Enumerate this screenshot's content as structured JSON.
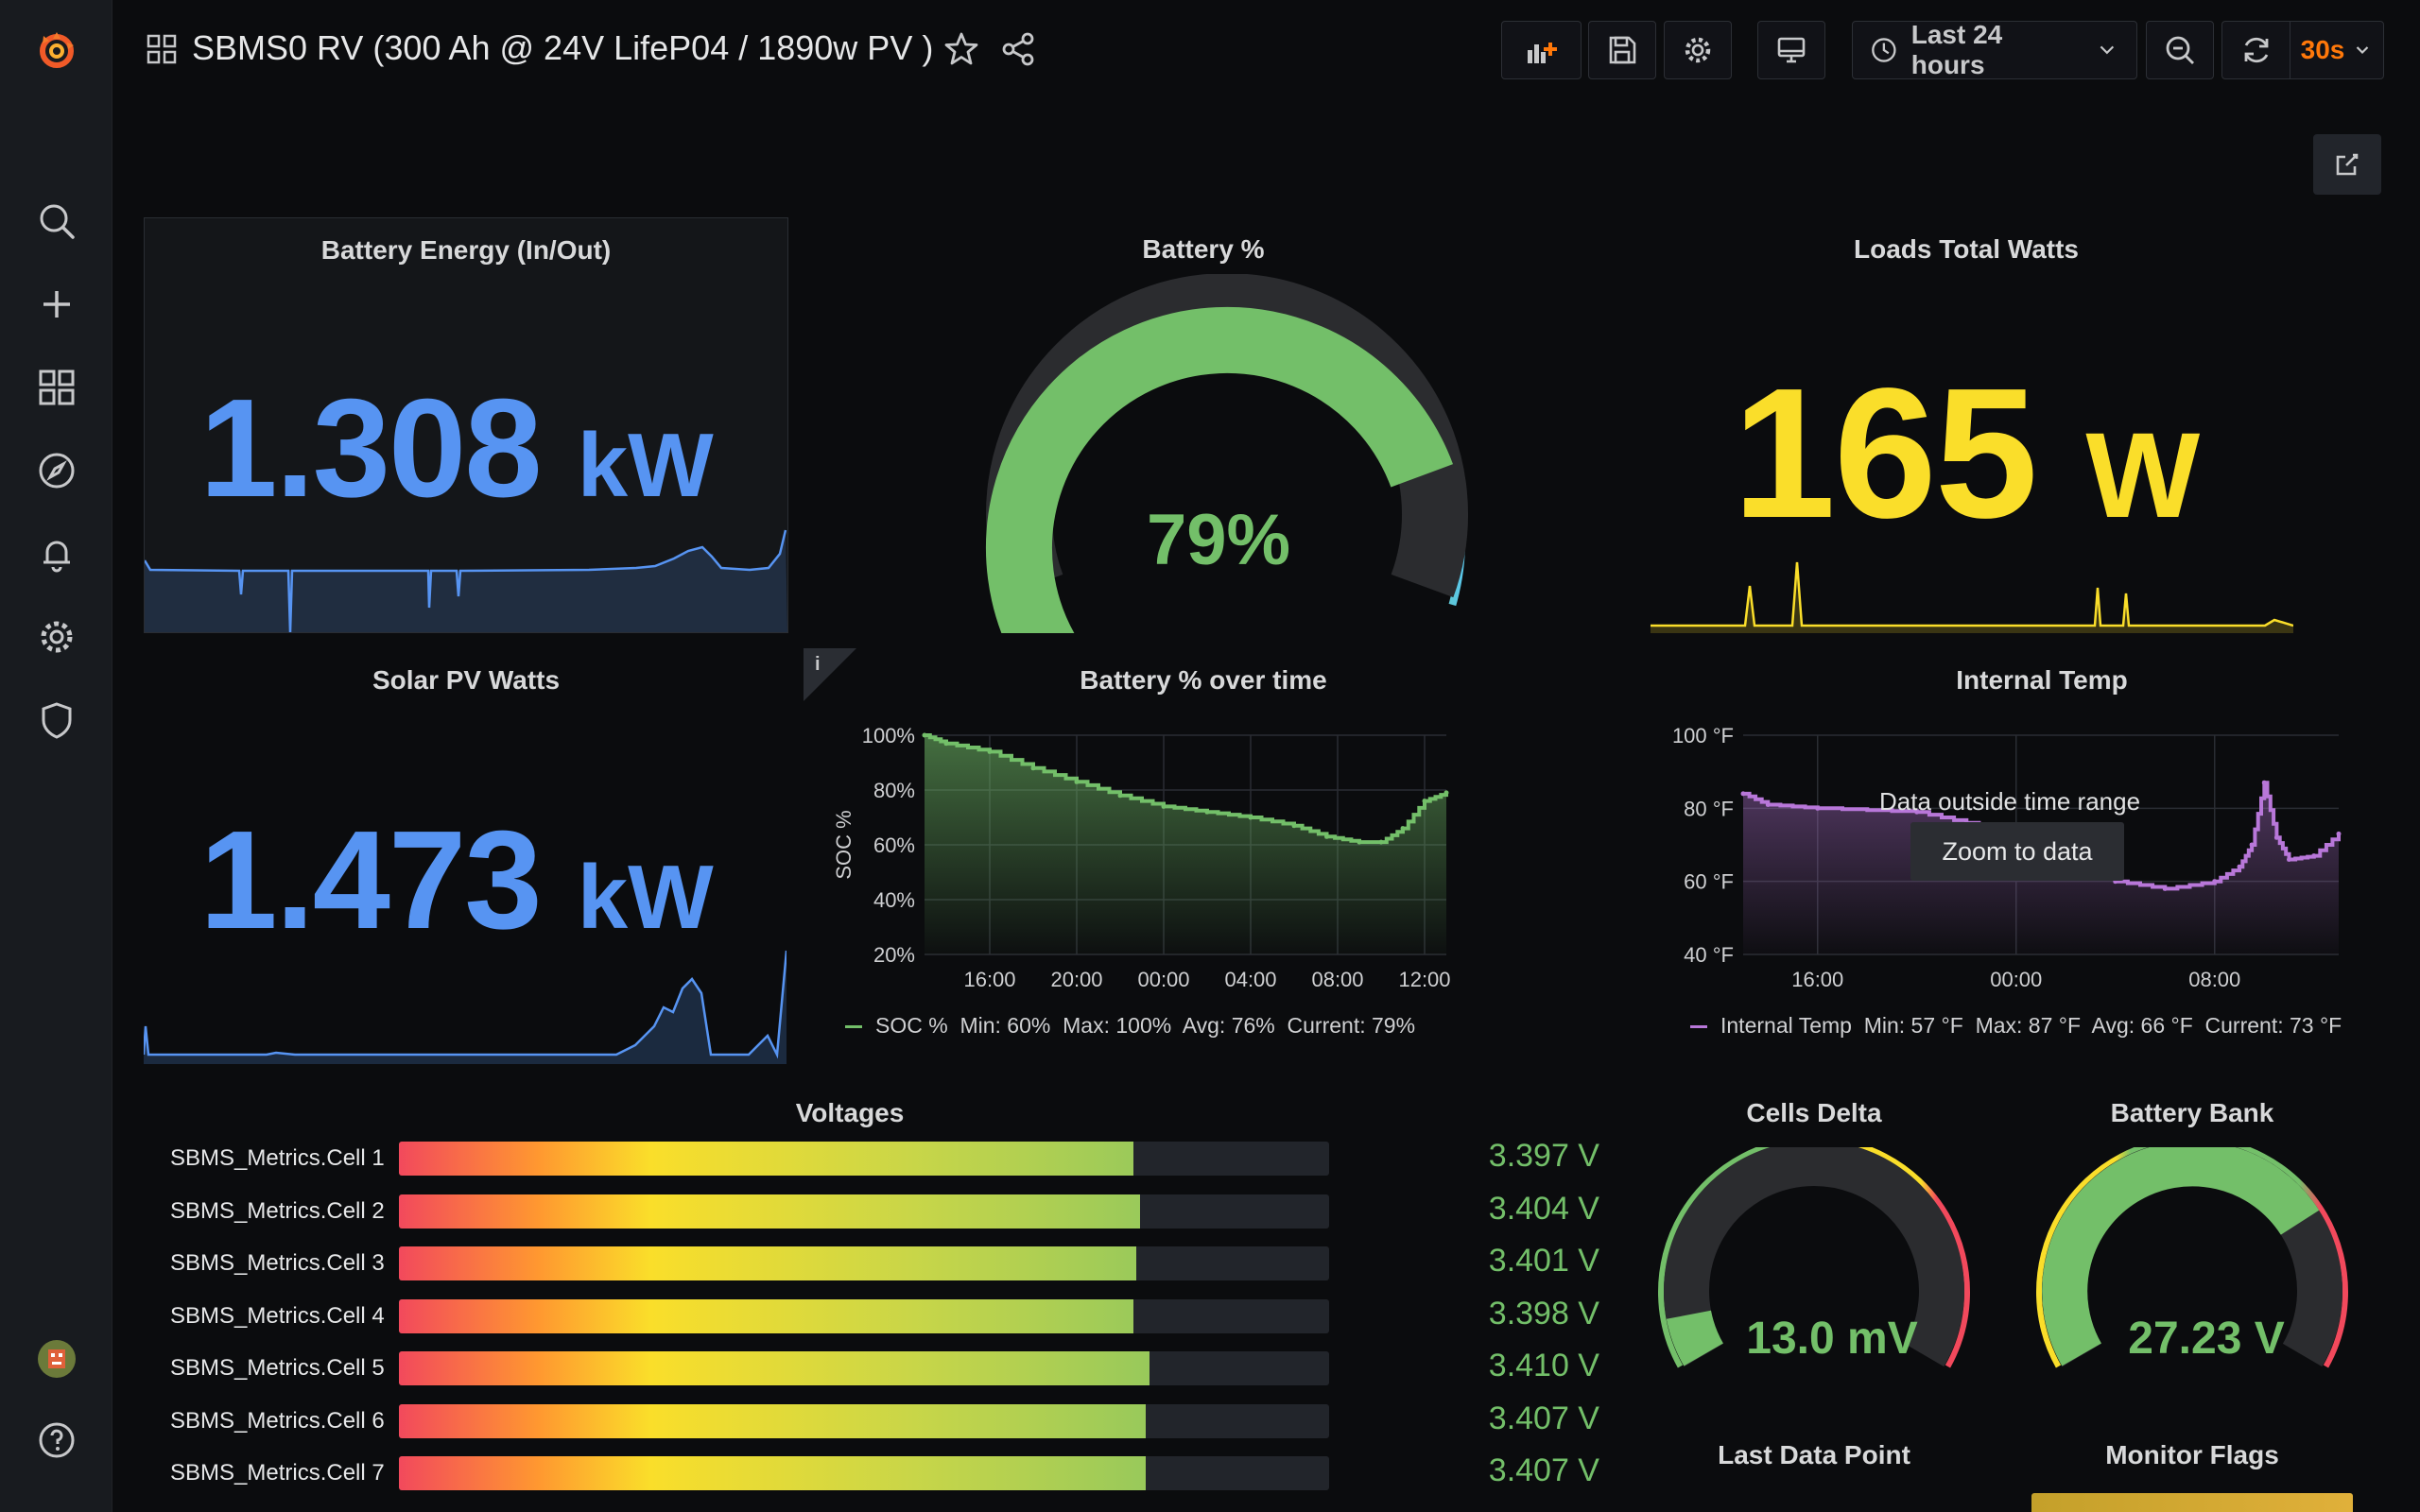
{
  "header": {
    "title": "SBMS0 RV (300 Ah @ 24V LifeP04 / 1890w PV )",
    "time_range": "Last 24 hours",
    "refresh_interval": "30s"
  },
  "sidebar": {
    "items": [
      "search-icon",
      "plus-icon",
      "dashboards-icon",
      "explore-icon",
      "alerting-icon",
      "settings-icon",
      "shield-icon"
    ]
  },
  "panels": {
    "battery_energy": {
      "title": "Battery Energy (In/Out)",
      "value": "1.308",
      "unit": "kW",
      "color": "#5794f2"
    },
    "battery_pct": {
      "title": "Battery %",
      "value": "79%",
      "percent": 79,
      "color": "#73bf69"
    },
    "loads": {
      "title": "Loads Total Watts",
      "value": "165",
      "unit": "W",
      "color": "#fade2a"
    },
    "solar": {
      "title": "Solar PV Watts",
      "value": "1.473",
      "unit": "kW",
      "color": "#5794f2"
    },
    "soc_over_time": {
      "title": "Battery % over time",
      "info_icon": "i",
      "legend": {
        "name": "SOC %",
        "min": "Min: 60%",
        "max": "Max: 100%",
        "avg": "Avg: 76%",
        "current": "Current: 79%"
      }
    },
    "internal_temp": {
      "title": "Internal Temp",
      "message": "Data outside time range",
      "zoom_label": "Zoom to data",
      "legend": {
        "name": "Internal Temp",
        "min": "Min: 57 °F",
        "max": "Max: 87 °F",
        "avg": "Avg: 66 °F",
        "current": "Current: 73 °F"
      }
    },
    "voltages": {
      "title": "Voltages",
      "cells": [
        {
          "label": "SBMS_Metrics.Cell 1",
          "value": "3.397 V",
          "fill": 0.79
        },
        {
          "label": "SBMS_Metrics.Cell 2",
          "value": "3.404 V",
          "fill": 0.797
        },
        {
          "label": "SBMS_Metrics.Cell 3",
          "value": "3.401 V",
          "fill": 0.793
        },
        {
          "label": "SBMS_Metrics.Cell 4",
          "value": "3.398 V",
          "fill": 0.79
        },
        {
          "label": "SBMS_Metrics.Cell 5",
          "value": "3.410 V",
          "fill": 0.807
        },
        {
          "label": "SBMS_Metrics.Cell 6",
          "value": "3.407 V",
          "fill": 0.803
        },
        {
          "label": "SBMS_Metrics.Cell 7",
          "value": "3.407 V",
          "fill": 0.803
        }
      ]
    },
    "cells_delta": {
      "title": "Cells Delta",
      "value": "13.0 mV",
      "fraction": 0.08
    },
    "battery_bank": {
      "title": "Battery Bank",
      "value": "27.23 V",
      "fraction": 0.74
    },
    "last_data_point": {
      "title": "Last Data Point"
    },
    "monitor_flags": {
      "title": "Monitor Flags"
    }
  },
  "chart_data": [
    {
      "type": "area",
      "title": "Battery % over time",
      "ylabel": "SOC %",
      "x_ticks": [
        "16:00",
        "20:00",
        "00:00",
        "04:00",
        "08:00",
        "12:00"
      ],
      "y_ticks": [
        "100%",
        "80%",
        "60%",
        "40%",
        "20%"
      ],
      "ylim": [
        20,
        100
      ],
      "series": [
        {
          "name": "SOC %",
          "color": "#73bf69",
          "x": [
            13.0,
            14.0,
            16.0,
            18.0,
            20.0,
            22.0,
            24.0,
            26.0,
            28.0,
            30.0,
            31.5,
            33.0,
            34.0,
            35.0,
            36.0,
            37.0
          ],
          "values": [
            100,
            97,
            94,
            88,
            83,
            78,
            74,
            72,
            70,
            67,
            63,
            61,
            61,
            66,
            76,
            79
          ]
        }
      ]
    },
    {
      "type": "line",
      "title": "Internal Temp",
      "x_ticks": [
        "16:00",
        "00:00",
        "08:00"
      ],
      "y_ticks": [
        "100 °F",
        "80 °F",
        "60 °F",
        "40 °F"
      ],
      "ylim": [
        40,
        100
      ],
      "series": [
        {
          "name": "Internal Temp",
          "color": "#b877d9",
          "x": [
            13.0,
            14.0,
            16.0,
            20.0,
            22.0,
            24.0,
            26.0,
            28.0,
            30.0,
            32.0,
            33.0,
            33.5,
            34.0,
            34.5,
            35.0,
            36.0,
            37.0
          ],
          "values": [
            84,
            81,
            80,
            79,
            76,
            71,
            63,
            60,
            58,
            60,
            64,
            70,
            87,
            72,
            66,
            67,
            73
          ]
        }
      ]
    }
  ]
}
